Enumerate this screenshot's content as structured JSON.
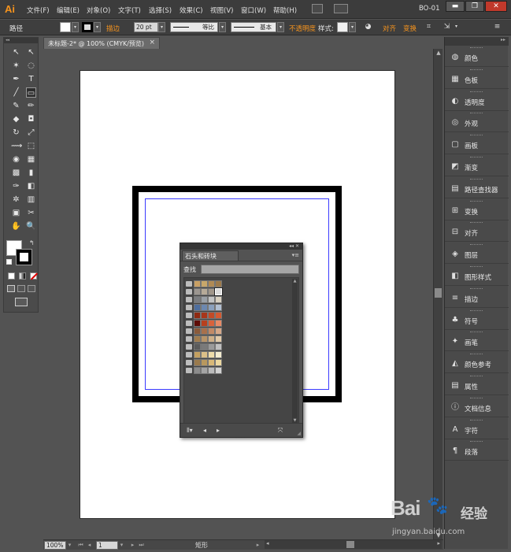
{
  "app": {
    "logo": "Ai",
    "workspace": "BO-01"
  },
  "menu": [
    "文件(F)",
    "编辑(E)",
    "对象(O)",
    "文字(T)",
    "选择(S)",
    "效果(C)",
    "视图(V)",
    "窗口(W)",
    "帮助(H)"
  ],
  "window_controls": {
    "minimize": "▬",
    "restore": "❐",
    "close": "✕"
  },
  "control_bar": {
    "selection_label": "路径",
    "stroke_label": "描边",
    "stroke_weight": "20 pt",
    "profile_label": "等比",
    "brush_label": "基本",
    "opacity_label": "不透明度",
    "style_label": "样式:",
    "align_label": "对齐",
    "transform_label": "变换",
    "fill_color": "#ffffff",
    "stroke_color": "#000000",
    "accent_color": "#f7941d"
  },
  "document": {
    "title": "未标题-2* @ 100% (CMYK/预览)",
    "close": "×"
  },
  "status": {
    "zoom": "100%",
    "artboard": "1",
    "tool": "矩形"
  },
  "tools": [
    "selection-tool-icon",
    "direct-selection-tool-icon",
    "magic-wand-tool-icon",
    "lasso-tool-icon",
    "pen-tool-icon",
    "type-tool-icon",
    "line-tool-icon",
    "rectangle-tool-icon",
    "paintbrush-tool-icon",
    "pencil-tool-icon",
    "blob-brush-tool-icon",
    "eraser-tool-icon",
    "rotate-tool-icon",
    "scale-tool-icon",
    "width-tool-icon",
    "free-transform-tool-icon",
    "shape-builder-tool-icon",
    "perspective-grid-tool-icon",
    "mesh-tool-icon",
    "gradient-tool-icon",
    "eyedropper-tool-icon",
    "blend-tool-icon",
    "symbol-sprayer-tool-icon",
    "column-graph-tool-icon",
    "artboard-tool-icon",
    "slice-tool-icon",
    "hand-tool-icon",
    "zoom-tool-icon"
  ],
  "dock": [
    {
      "label": "颜色",
      "icon": "color-icon"
    },
    {
      "label": "色板",
      "icon": "swatches-icon"
    },
    {
      "label": "透明度",
      "icon": "transparency-icon"
    },
    {
      "label": "外观",
      "icon": "appearance-icon"
    },
    {
      "label": "画板",
      "icon": "artboards-icon"
    },
    {
      "label": "渐变",
      "icon": "gradient-icon"
    },
    {
      "label": "路径查找器",
      "icon": "pathfinder-icon"
    },
    {
      "label": "变换",
      "icon": "transform-icon"
    },
    {
      "label": "对齐",
      "icon": "align-icon"
    },
    {
      "label": "图层",
      "icon": "layers-icon"
    },
    {
      "label": "图形样式",
      "icon": "graphic-styles-icon"
    },
    {
      "label": "描边",
      "icon": "stroke-icon"
    },
    {
      "label": "符号",
      "icon": "symbols-icon"
    },
    {
      "label": "画笔",
      "icon": "brushes-icon"
    },
    {
      "label": "颜色参考",
      "icon": "color-guide-icon"
    },
    {
      "label": "属性",
      "icon": "attributes-icon"
    },
    {
      "label": "文档信息",
      "icon": "document-info-icon"
    },
    {
      "label": "字符",
      "icon": "character-icon"
    },
    {
      "label": "段落",
      "icon": "paragraph-icon"
    }
  ],
  "swatch_library": {
    "tab": "石头和砖块",
    "find_label": "查找",
    "find_value": "",
    "rows": [
      [
        "#c9a064",
        "#c8a76a",
        "#b08a55",
        "#9c7a4c"
      ],
      [
        "#9c9690",
        "#b6aa98",
        "#a0968a",
        "#dcdcdc"
      ],
      [
        "#7b7d80",
        "#9aa0a6",
        "#c3c4c4",
        "#d8d0c0"
      ],
      [
        "#4e6e9e",
        "#6c88b0",
        "#8aa0bd",
        "#b2c0d2"
      ],
      [
        "#8f2a12",
        "#a8361a",
        "#c24a26",
        "#d45a32"
      ],
      [
        "#5e0c06",
        "#b8401e",
        "#d8623c",
        "#e88a66"
      ],
      [
        "#8a5a3a",
        "#a8704c",
        "#c28a66",
        "#d6a888"
      ],
      [
        "#a07c4e",
        "#b89468",
        "#cfb088",
        "#e2caa8"
      ],
      [
        "#5a5a5a",
        "#7a7a7a",
        "#9a9a9a",
        "#c0c0c0"
      ],
      [
        "#c4a060",
        "#dcc088",
        "#eedcaa",
        "#f4ecd0"
      ],
      [
        "#9a7a4c",
        "#b8985e",
        "#d8b878",
        "#ecd8a0"
      ],
      [
        "#8c8c8c",
        "#a4a4a4",
        "#bcbcbc",
        "#d2d2d2"
      ]
    ],
    "selected": [
      1,
      3
    ]
  },
  "watermark": {
    "main": "Bai",
    "cn": "经验",
    "url": "jingyan.baidu.com"
  }
}
